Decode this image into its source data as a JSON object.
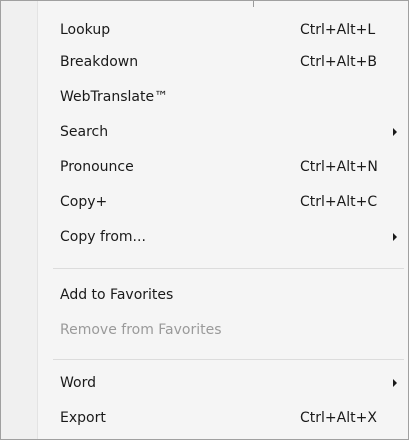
{
  "menu": {
    "items": [
      {
        "label": "Lookup",
        "shortcut": "Ctrl+Alt+L"
      },
      {
        "label": "Breakdown",
        "shortcut": "Ctrl+Alt+B"
      },
      {
        "label": "WebTranslate™",
        "shortcut": ""
      },
      {
        "label": "Search",
        "shortcut": "",
        "submenu_icon": "submenu-arrow-icon"
      },
      {
        "label": "Pronounce",
        "shortcut": "Ctrl+Alt+N"
      },
      {
        "label": "Copy+",
        "shortcut": "Ctrl+Alt+C"
      },
      {
        "label": "Copy from...",
        "shortcut": "",
        "submenu_icon": "submenu-arrow-icon"
      },
      {
        "label": "Add to Favorites",
        "shortcut": ""
      },
      {
        "label": "Remove from Favorites",
        "shortcut": "",
        "disabled": true
      },
      {
        "label": "Word",
        "shortcut": "",
        "submenu_icon": "submenu-arrow-icon"
      },
      {
        "label": "Export",
        "shortcut": "Ctrl+Alt+X"
      }
    ]
  },
  "colors": {
    "background": "#f5f5f5",
    "text": "#1a1a1a",
    "disabled_text": "#9a9a9a",
    "separator": "#dcdcdc"
  }
}
